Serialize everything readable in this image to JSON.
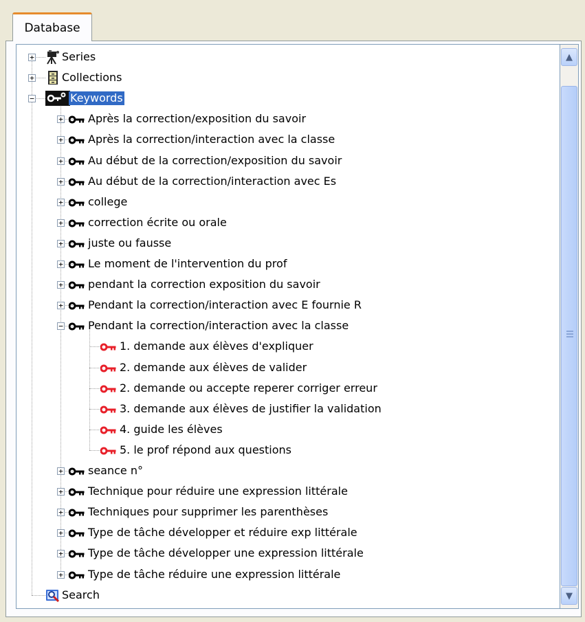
{
  "tab": {
    "label": "Database"
  },
  "tree": {
    "roots": [
      {
        "label": "Series",
        "icon": "camera-icon",
        "expanded": false
      },
      {
        "label": "Collections",
        "icon": "cabinet-icon",
        "expanded": false
      },
      {
        "label": "Keywords",
        "icon": "keys-icon",
        "expanded": true,
        "selected": true
      },
      {
        "label": "Search",
        "icon": "search-icon",
        "expanded": false
      }
    ],
    "keywords": [
      "Après la correction/exposition du savoir",
      "Après la correction/interaction avec la classe",
      "Au début de la correction/exposition du savoir",
      "Au début de la correction/interaction avec Es",
      "college",
      "correction écrite ou orale",
      "juste ou fausse",
      "Le moment de l'intervention du prof",
      "pendant la correction exposition du savoir",
      "Pendant la correction/interaction avec E fournie R",
      "Pendant la correction/interaction avec la classe",
      "seance n°",
      "Technique pour réduire une expression littérale",
      "Techniques pour supprimer les parenthèses",
      "Type de tâche développer et réduire exp littérale",
      "Type de tâche développer une expression littérale",
      "Type de tâche réduire une expression littérale"
    ],
    "subkeywords": [
      "1. demande aux élèves d'expliquer",
      "2. demande aux élèves de valider",
      "2. demande ou accepte reperer corriger erreur",
      "3. demande aux élèves de justifier la validation",
      "4. guide les élèves",
      "5. le prof répond aux questions"
    ]
  },
  "colors": {
    "selection": "#316ac5",
    "tab_accent": "#e68b2c",
    "sub_key": "#e8202a",
    "key": "#000000"
  }
}
